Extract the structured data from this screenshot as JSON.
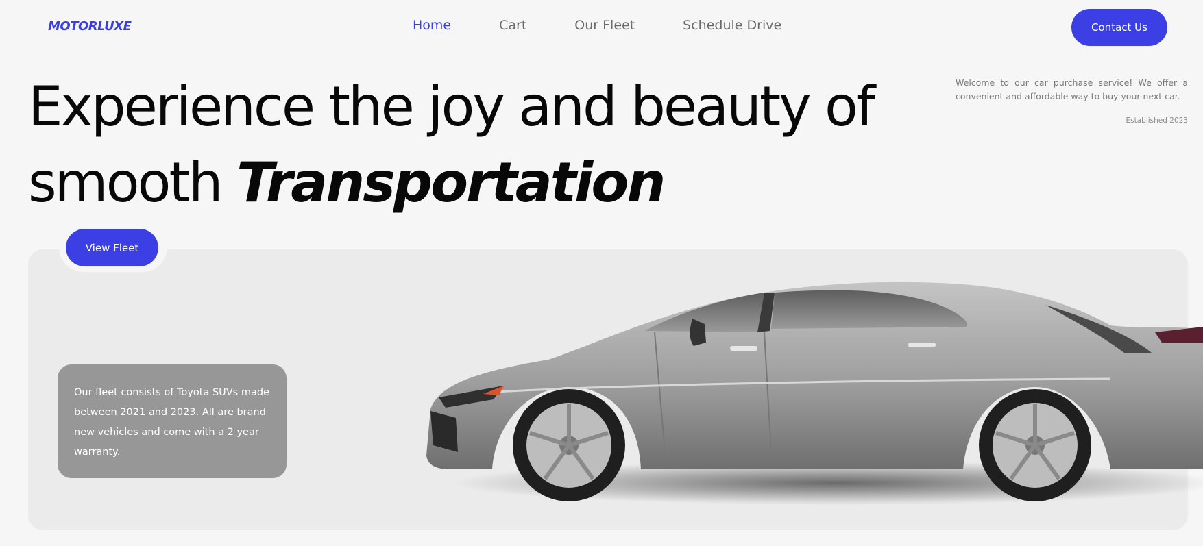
{
  "header": {
    "logo": "MOTORLUXE",
    "nav": [
      {
        "label": "Home",
        "active": true
      },
      {
        "label": "Cart",
        "active": false
      },
      {
        "label": "Our Fleet",
        "active": false
      },
      {
        "label": "Schedule Drive",
        "active": false
      }
    ],
    "contact_label": "Contact Us"
  },
  "hero": {
    "title_line1": "Experience the joy and beauty of",
    "title_line2_plain": "smooth",
    "title_line2_emphasis": "Transportation",
    "intro": "Welcome to our car purchase service! We offer a convenient and affordable way to buy your next car.",
    "established": "Established 2023",
    "cta_label": "View Fleet",
    "fleet_info": "Our fleet consists of Toyota SUVs made between 2021 and 2023. All are brand new vehicles and come with a 2 year warranty."
  },
  "icons": [
    "car-image"
  ],
  "colors": {
    "accent": "#3b3fe4",
    "background": "#f6f6f6",
    "card": "#ebebeb",
    "info_box": "#979797"
  }
}
